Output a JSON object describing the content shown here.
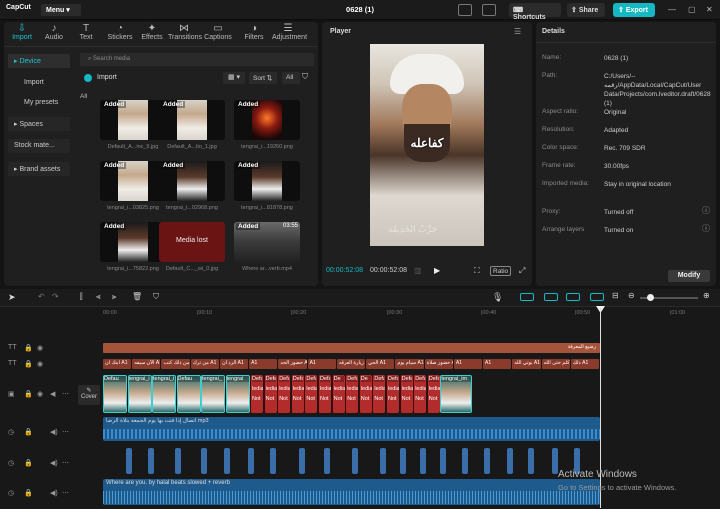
{
  "titlebar": {
    "app": "CapCut",
    "menu": "Menu",
    "project": "0628 (1)",
    "shortcuts": "Shortcuts",
    "share": "Share",
    "export": "Export"
  },
  "tools": [
    {
      "label": "Import",
      "icon": "import-icon",
      "glyph": "⇩"
    },
    {
      "label": "Audio",
      "icon": "audio-icon",
      "glyph": "♪"
    },
    {
      "label": "Text",
      "icon": "text-icon",
      "glyph": "T"
    },
    {
      "label": "Stickers",
      "icon": "stickers-icon",
      "glyph": "◔"
    },
    {
      "label": "Effects",
      "icon": "effects-icon",
      "glyph": "✦"
    },
    {
      "label": "Transitions",
      "icon": "transitions-icon",
      "glyph": "⋈"
    },
    {
      "label": "Captions",
      "icon": "captions-icon",
      "glyph": "▭"
    },
    {
      "label": "Filters",
      "icon": "filters-icon",
      "glyph": "◑"
    },
    {
      "label": "Adjustment",
      "icon": "adjustment-icon",
      "glyph": "☰"
    }
  ],
  "sidebar": {
    "device": "Device",
    "import": "Import",
    "my_presets": "My presets",
    "spaces": "Spaces",
    "stock": "Stock mate...",
    "brand": "Brand assets"
  },
  "media": {
    "search_placeholder": "Search media",
    "import_label": "Import",
    "sort": "Sort",
    "all_filter": "All",
    "all_label": "All",
    "added": "Added",
    "media_lost": "Media lost",
    "duration": "03:55",
    "items": [
      {
        "name": "Default_A...inc_9.jpg",
        "added": true
      },
      {
        "name": "Default_A...tio_1.jpg",
        "added": true
      },
      {
        "name": "tengrai_i...19250.png",
        "added": true
      },
      {
        "name": "tengrai_i...03825.png",
        "added": true
      },
      {
        "name": "tengrai_i...02968.png",
        "added": true
      },
      {
        "name": "tengrai_i...81878.png",
        "added": true
      },
      {
        "name": "tengrai_i...75822.png",
        "added": true
      },
      {
        "name": "Default_C..._wi_0.jpg",
        "added": false
      },
      {
        "name": "Where ar...verb.mp4",
        "added": true
      }
    ]
  },
  "player": {
    "title": "Player",
    "caption": "كفاعله",
    "watermark": "حَرِّبُ الخَدِيقَة",
    "time_current": "00:00:52:08",
    "time_total": "00:00:52:08",
    "ratio": "Ratio"
  },
  "details": {
    "title": "Details",
    "rows": [
      {
        "label": "Name:",
        "value": "0628 (1)"
      },
      {
        "label": "Path:",
        "value": "C:/Users/--رقمه/AppData/Local/CapCut/User Data/Projects/com.lveditor.draft/0628 (1)"
      },
      {
        "label": "Aspect ratio:",
        "value": "Original"
      },
      {
        "label": "Resolution:",
        "value": "Adapted"
      },
      {
        "label": "Color space:",
        "value": "Rec. 709 SDR"
      },
      {
        "label": "Frame rate:",
        "value": "30.00fps"
      },
      {
        "label": "Imported media:",
        "value": "Stay in original location"
      },
      {
        "label": "Proxy:",
        "value": "Turned off"
      },
      {
        "label": "Arrange layers",
        "value": "Turned on"
      }
    ],
    "modify": "Modify"
  },
  "timeline": {
    "ruler": [
      "00:00",
      "|00:10",
      "|00:20",
      "|00:30",
      "|00:40",
      "|00:50",
      "|01:00"
    ],
    "text_track_label": "رضيع المعرفة",
    "captions": [
      "ابنك ان A1",
      "الآن سيفه A1",
      "من ذلك كتب A1",
      "من ترك A1",
      "الرد ان A1",
      "A1",
      "حضور الحد A1",
      "A1",
      "زيارة العرقه A1",
      "الحي A1",
      "سيام يوم A1",
      "حضور صلاة A1",
      "A1",
      "A1",
      "بوتي الله A1",
      "كلم حتى الله A1",
      "ذلك A1"
    ],
    "cover": "Cover",
    "video_clips": [
      "Defau",
      "tengrai_i",
      "tengrai_i",
      "Defau",
      "tengrai_",
      "tengrai",
      "Defaul",
      "Defa",
      "Defa",
      "Defaul",
      "Defa",
      "Defa",
      "De",
      "Defa",
      "De",
      "Defa",
      "Defa",
      "Defa",
      "Defa",
      "Defa",
      "tengrai_im"
    ],
    "media_clip_text": "ledia",
    "not_text": "Not",
    "audio1": "اتصال إذا فتت بها يوم الجمعة بتلاة الرضا mp3",
    "audio3": "Where are you. by halal beats slowed + reverb"
  },
  "watermark": {
    "line1": "Activate Windows",
    "line2": "Go to Settings to activate Windows."
  }
}
